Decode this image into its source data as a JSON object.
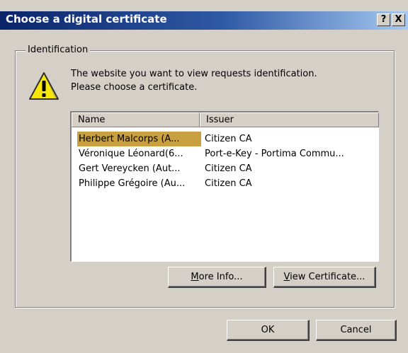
{
  "window": {
    "title": "Choose a digital certificate",
    "help_label": "?",
    "close_label": "X"
  },
  "identification": {
    "group_label": "Identification",
    "message_line1": "The website you want to view requests identification.",
    "message_line2": "Please choose a certificate."
  },
  "certificate_list": {
    "columns": [
      "Name",
      "Issuer"
    ],
    "rows": [
      {
        "name": "Herbert Malcorps (A...",
        "issuer": "Citizen CA",
        "selected": true
      },
      {
        "name": "Véronique Léonard(6...",
        "issuer": "Port-e-Key - Portima Commu...",
        "selected": false
      },
      {
        "name": "Gert Vereycken (Aut...",
        "issuer": "Citizen CA",
        "selected": false
      },
      {
        "name": "Philippe Grégoire (Au...",
        "issuer": "Citizen CA",
        "selected": false
      }
    ]
  },
  "buttons": {
    "more_info_accel": "M",
    "more_info_rest": "ore Info...",
    "view_cert_accel": "V",
    "view_cert_rest": "iew Certificate...",
    "ok": "OK",
    "cancel": "Cancel"
  },
  "colors": {
    "titlebar_start": "#0a246a",
    "titlebar_end": "#a6caf0",
    "selection": "#c8a040",
    "face": "#d4d0c8"
  }
}
